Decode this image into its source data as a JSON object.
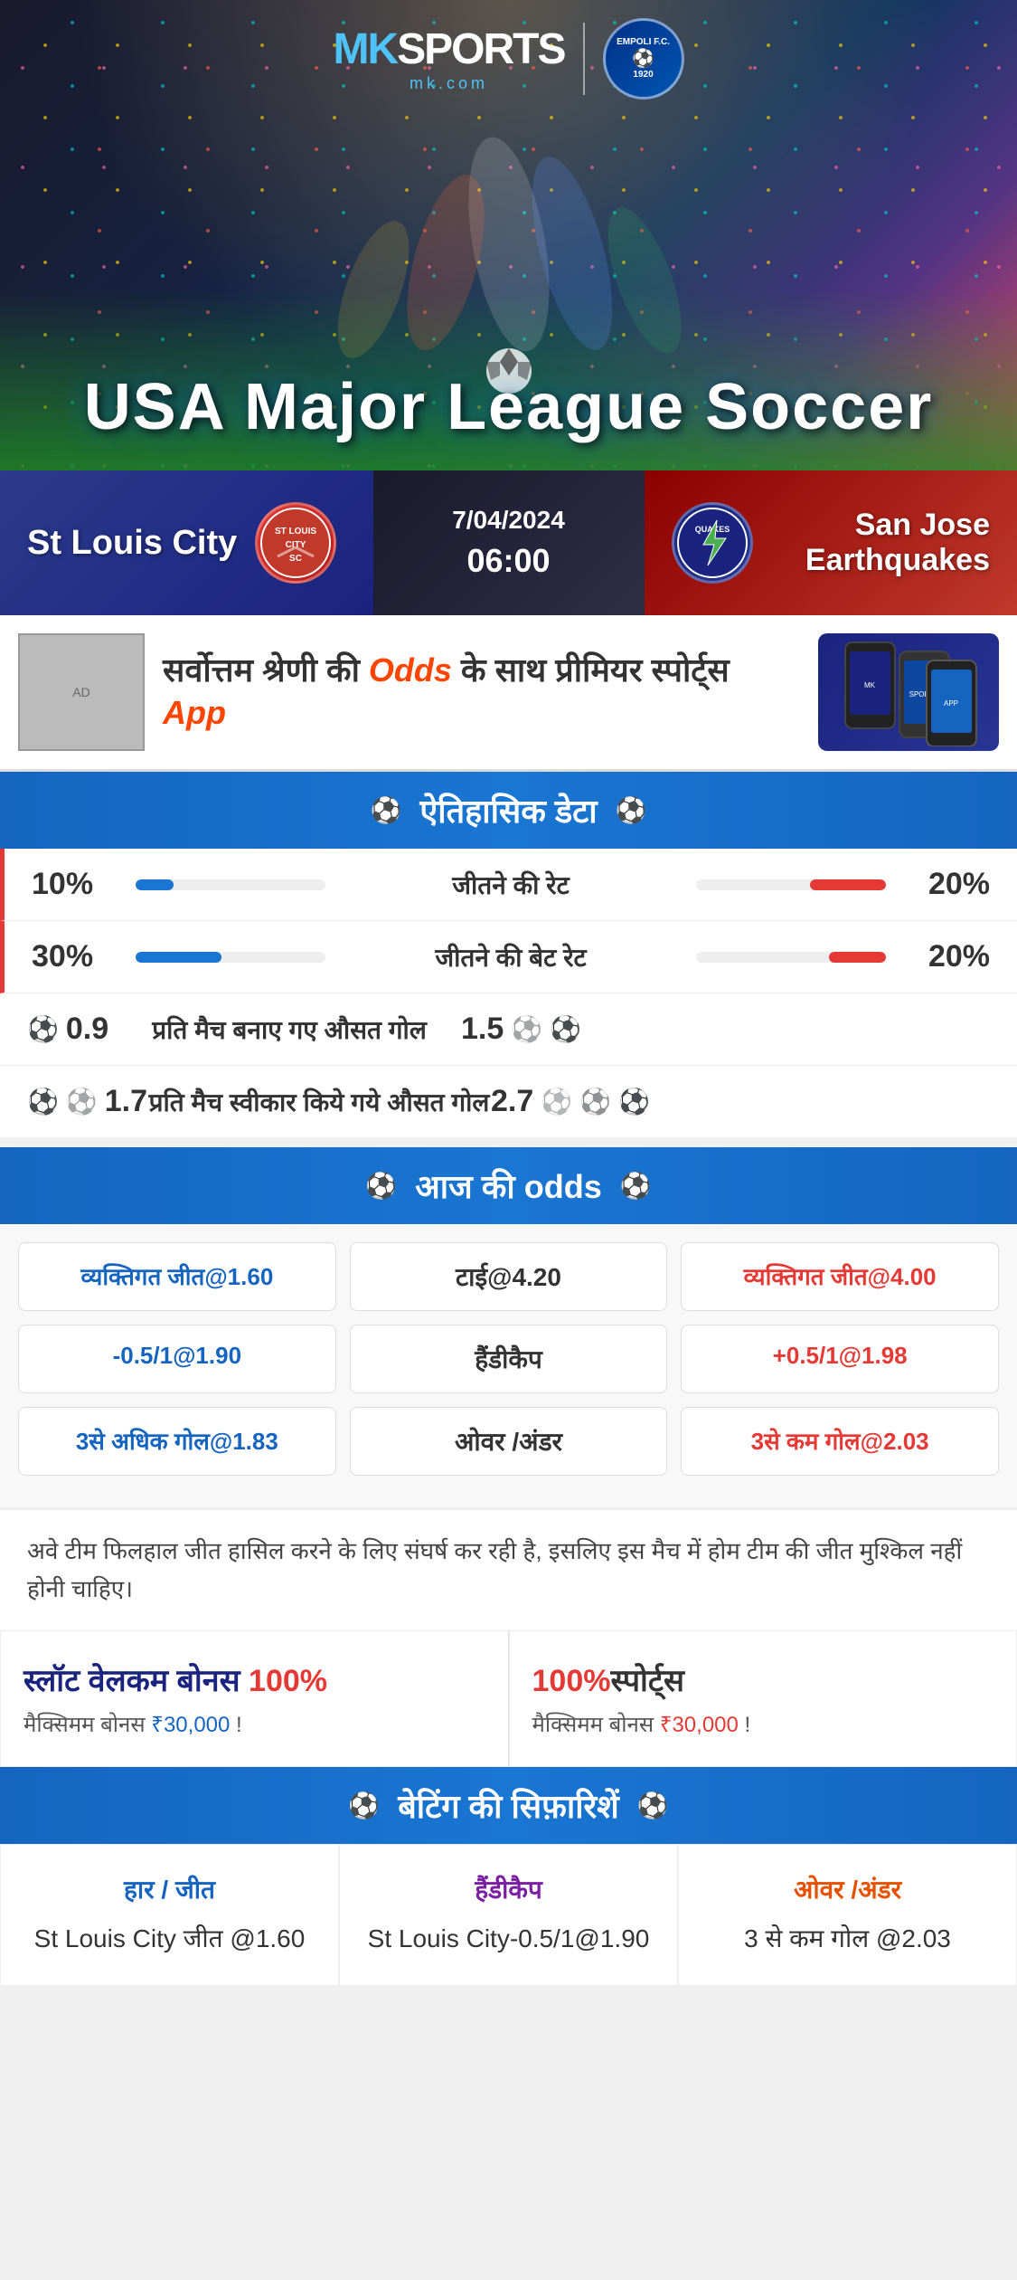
{
  "brand": {
    "name": "MK SPORTS",
    "mk_text": "MK",
    "sports_text": "SPORTS",
    "url": "mk.com",
    "partner": "EMPOLI F.C.",
    "partner_sub": "1920"
  },
  "hero": {
    "title_line1": "USA Major League Soccer"
  },
  "match": {
    "home_team": "St Louis City",
    "away_team": "San Jose Earthquakes",
    "date": "7/04/2024",
    "time": "06:00",
    "home_logo": "CITY SC",
    "away_logo": "QUAKES"
  },
  "promo": {
    "main_text": "सर्वोत्तम श्रेणी की ",
    "highlight": "Odds",
    "suffix": " के साथ प्रीमियर स्पोर्ट्स ",
    "app": "App"
  },
  "historical_section": {
    "title": "ऐतिहासिक डेटा"
  },
  "stats": [
    {
      "label": "जीतने की रेट",
      "left_value": "10%",
      "right_value": "20%",
      "left_pct": 20,
      "right_pct": 40
    },
    {
      "label": "जीतने की बेट रेट",
      "left_value": "30%",
      "right_value": "20%",
      "left_pct": 45,
      "right_pct": 30
    },
    {
      "label": "प्रति मैच बनाए गए औसत गोल",
      "left_value": "0.9",
      "right_value": "1.5",
      "left_balls": 1,
      "right_balls": 2
    },
    {
      "label": "प्रति मैच स्वीकार किये गये औसत गोल",
      "left_value": "1.7",
      "right_value": "2.7",
      "left_balls": 2,
      "right_balls": 3
    }
  ],
  "odds_section": {
    "title": "आज की odds"
  },
  "odds": {
    "row1": {
      "left_label": "व्यक्तिगत जीत@1.60",
      "center_label": "टाई@4.20",
      "right_label": "व्यक्तिगत जीत@4.00"
    },
    "row2": {
      "left_label": "-0.5/1@1.90",
      "center_label": "हैंडीकैप",
      "right_label": "+0.5/1@1.98"
    },
    "row3": {
      "left_label": "3से अधिक गोल@1.83",
      "center_label": "ओवर /अंडर",
      "right_label": "3से कम गोल@2.03"
    }
  },
  "analysis": {
    "text": "अवे टीम फिलहाल जीत हासिल करने के लिए संघर्ष कर रही है, इसलिए इस मैच में होम टीम की जीत मुश्किल नहीं होनी चाहिए।"
  },
  "bonus": {
    "left_title": "स्लॉट वेलकम बोनस ",
    "left_highlight": "100%",
    "left_subtitle": "मैक्सिमम बोनस ₹30,000  !",
    "right_title": "100%",
    "right_title2": "स्पोर्ट्स",
    "right_subtitle": "मैक्सिमम बोनस  ₹30,000 !"
  },
  "betting_section": {
    "title": "बेटिंग की सिफ़ारिशें"
  },
  "betting_recommendations": [
    {
      "label": "हार / जीत",
      "value": "St Louis City जीत @1.60",
      "color": "blue"
    },
    {
      "label": "हैंडीकैप",
      "value": "St Louis City-0.5/1@1.90",
      "color": "purple"
    },
    {
      "label": "ओवर /अंडर",
      "value": "3 से कम गोल @2.03",
      "color": "orange"
    }
  ]
}
